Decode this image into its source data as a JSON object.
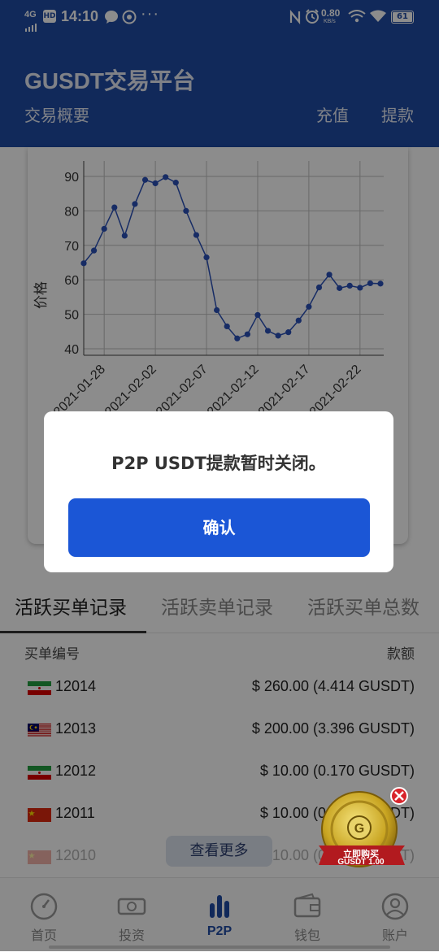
{
  "status_bar": {
    "network": "4G",
    "hd": "HD",
    "time": "14:10",
    "speed_value": "0.80",
    "speed_unit": "KB/s",
    "battery": "61"
  },
  "header": {
    "title": "GUSDT交易平台",
    "subtitle": "交易概要",
    "recharge_label": "充值",
    "withdraw_label": "提款"
  },
  "chart_data": {
    "type": "line",
    "ylabel": "价格",
    "xlabel": "",
    "ylim": [
      40,
      90
    ],
    "yticks": [
      40,
      50,
      60,
      70,
      80,
      90
    ],
    "xtick_labels": [
      "2021-01-28",
      "2021-02-02",
      "2021-02-07",
      "2021-02-12",
      "2021-02-17",
      "2021-02-22"
    ],
    "xtick_dates_index": [
      2,
      7,
      12,
      17,
      22,
      27
    ],
    "grid": true,
    "color": "#2a50b8",
    "x_start": "2021-01-26",
    "series": [
      {
        "values": [
          64.8,
          68.5,
          74.8,
          81.0,
          72.8,
          82.0,
          89.0,
          88.0,
          89.8,
          88.2,
          80.0,
          73.0,
          66.5,
          51.2,
          46.5,
          43.0,
          44.2,
          49.8,
          45.2,
          43.8,
          44.8,
          48.2,
          52.2,
          57.8,
          61.5,
          57.6,
          58.3,
          57.7,
          59.0,
          58.9
        ]
      }
    ]
  },
  "dialog": {
    "message": "P2P USDT提款暂时关闭。",
    "confirm_label": "确认"
  },
  "tabs": [
    {
      "label": "活跃买单记录"
    },
    {
      "label": "活跃卖单记录"
    },
    {
      "label": "活跃买单总数"
    }
  ],
  "list": {
    "col_id": "买单编号",
    "col_amount": "款额",
    "rows": [
      {
        "flag": "iran-flag",
        "id": "12014",
        "amount": "$ 260.00  (4.414 GUSDT)"
      },
      {
        "flag": "malaysia-flag",
        "id": "12013",
        "amount": "$ 200.00  (3.396 GUSDT)"
      },
      {
        "flag": "iran-flag",
        "id": "12012",
        "amount": "$ 10.00  (0.170 GUSDT)"
      },
      {
        "flag": "china-flag",
        "id": "12011",
        "amount": "$ 10.00  (0.170 GUSDT)"
      },
      {
        "flag": "china-flag",
        "id": "12010",
        "amount": "$ 10.00  (0.170 GUSDT)"
      }
    ],
    "more_label": "查看更多"
  },
  "promo": {
    "line1": "立即购买",
    "line2": "GUSDT 1.00"
  },
  "nav": [
    {
      "label": "首页",
      "icon": "speedometer-icon"
    },
    {
      "label": "投资",
      "icon": "cash-icon"
    },
    {
      "label": "P2P",
      "icon": "bar-chart-icon"
    },
    {
      "label": "钱包",
      "icon": "wallet-icon"
    },
    {
      "label": "账户",
      "icon": "account-icon"
    }
  ]
}
